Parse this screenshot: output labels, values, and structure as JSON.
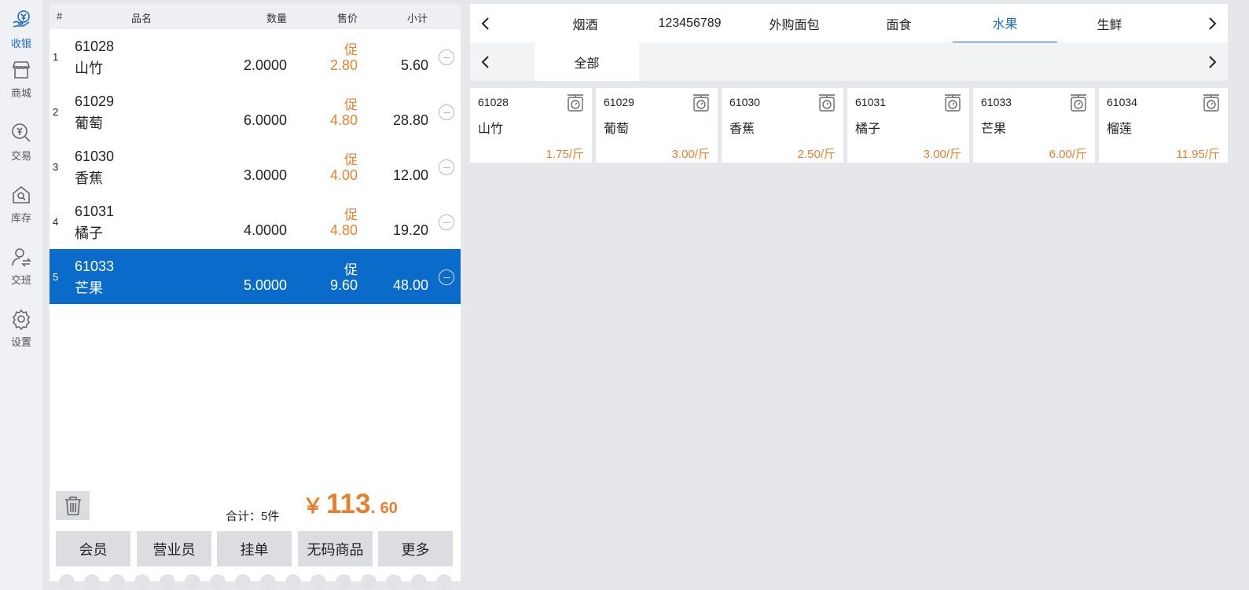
{
  "nav": {
    "items": [
      {
        "label": "收银",
        "icon": "cashier-icon",
        "active": true
      },
      {
        "label": "商城",
        "icon": "store-icon"
      },
      {
        "label": "交易",
        "icon": "transaction-icon"
      },
      {
        "label": "库存",
        "icon": "inventory-icon"
      },
      {
        "label": "交班",
        "icon": "shift-handover-icon"
      },
      {
        "label": "设置",
        "icon": "gear-icon"
      }
    ]
  },
  "cart": {
    "headers": {
      "idx": "#",
      "name": "品名",
      "qty": "数量",
      "price": "售价",
      "subtotal": "小计"
    },
    "rows": [
      {
        "idx": "1",
        "code": "61028",
        "name": "山竹",
        "qty": "2.0000",
        "promo": "促",
        "price": "2.80",
        "subtotal": "5.60"
      },
      {
        "idx": "2",
        "code": "61029",
        "name": "葡萄",
        "qty": "6.0000",
        "promo": "促",
        "price": "4.80",
        "subtotal": "28.80"
      },
      {
        "idx": "3",
        "code": "61030",
        "name": "香蕉",
        "qty": "3.0000",
        "promo": "促",
        "price": "4.00",
        "subtotal": "12.00"
      },
      {
        "idx": "4",
        "code": "61031",
        "name": "橘子",
        "qty": "4.0000",
        "promo": "促",
        "price": "4.80",
        "subtotal": "19.20"
      },
      {
        "idx": "5",
        "code": "61033",
        "name": "芒果",
        "qty": "5.0000",
        "promo": "促",
        "price": "9.60",
        "subtotal": "48.00",
        "selected": true
      }
    ],
    "total_label": "合计：5件",
    "total_currency": "￥",
    "total_int": "113",
    "total_dot": ".",
    "total_dec": "60",
    "buttons": [
      "会员",
      "营业员",
      "挂单",
      "无码商品",
      "更多"
    ]
  },
  "categories": {
    "tabs": [
      "烟酒",
      "123456789",
      "外购面包",
      "面食",
      "水果",
      "生鲜"
    ],
    "active_tab": "水果",
    "sub_tabs": [
      "全部"
    ]
  },
  "products": [
    {
      "code": "61028",
      "name": "山竹",
      "price": "1.75/斤"
    },
    {
      "code": "61029",
      "name": "葡萄",
      "price": "3.00/斤"
    },
    {
      "code": "61030",
      "name": "香蕉",
      "price": "2.50/斤"
    },
    {
      "code": "61031",
      "name": "橘子",
      "price": "3.00/斤"
    },
    {
      "code": "61033",
      "name": "芒果",
      "price": "6.00/斤"
    },
    {
      "code": "61034",
      "name": "榴莲",
      "price": "11.95/斤"
    }
  ],
  "colors": {
    "accent": "#0b6bcb",
    "price": "#ea7f2b",
    "nav_active": "#1a6ac8"
  }
}
